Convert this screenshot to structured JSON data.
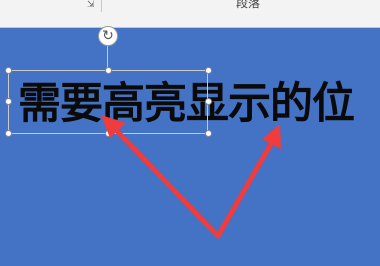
{
  "ribbon": {
    "launcher_icon": "dialog-launcher-icon",
    "group_label": "段落"
  },
  "slide": {
    "headline": "需要高亮显示的位",
    "rotate_icon": "rotate-icon"
  },
  "colors": {
    "slide_background": "#4472c4",
    "arrow": "#f03c3c",
    "ribbon_background": "#f3f3f3"
  }
}
